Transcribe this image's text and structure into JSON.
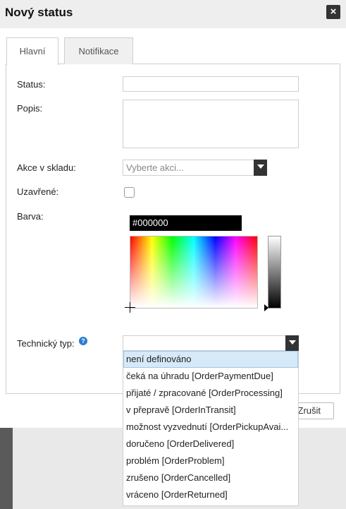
{
  "dialog": {
    "title": "Nový status",
    "close_glyph": "×"
  },
  "tabs": [
    {
      "label": "Hlavní",
      "active": true
    },
    {
      "label": "Notifikace",
      "active": false
    }
  ],
  "form": {
    "status_label": "Status:",
    "status_value": "",
    "description_label": "Popis:",
    "description_value": "",
    "stock_action_label": "Akce v skladu:",
    "stock_action_placeholder": "Vyberte akci...",
    "closed_label": "Uzavřené:",
    "closed_checked": false,
    "color_label": "Barva:",
    "color_hex": "#000000",
    "tech_type_label": "Technický typ:",
    "tech_type_value": "",
    "help_glyph": "?"
  },
  "dropdown_options": [
    "není definováno",
    "čeká na úhradu [OrderPaymentDue]",
    "přijaté / zpracované [OrderProcessing]",
    "v přepravě [OrderInTransit]",
    "možnost vyzvednutí [OrderPickupAvai...",
    "doručeno [OrderDelivered]",
    "problém [OrderProblem]",
    "zrušeno [OrderCancelled]",
    "vráceno [OrderReturned]"
  ],
  "dropdown_selected_index": 0,
  "footer": {
    "cancel_label": "Zrušit"
  },
  "colors": {
    "accent": "#2b7bd0",
    "selection": "#d6e9f8",
    "dark_button": "#333333"
  },
  "icons": [
    "close-icon",
    "chevron-down-icon",
    "help-icon"
  ]
}
